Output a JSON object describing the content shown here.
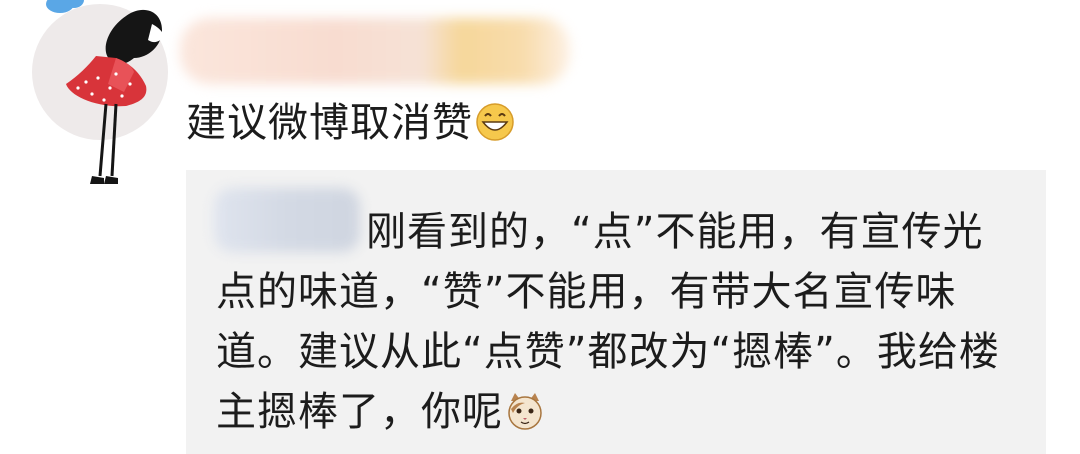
{
  "post": {
    "text": "建议微博取消赞",
    "emoji": "grinning-face-emoji"
  },
  "reply": {
    "text": "刚看到的，“点”不能用，有宣传光点的味道，“赞”不能用，有带大名宣传味道。建议从此“点赞”都改为“摁棒”。我给楼主摁棒了，你呢",
    "emoji": "cat-face-emoji"
  }
}
